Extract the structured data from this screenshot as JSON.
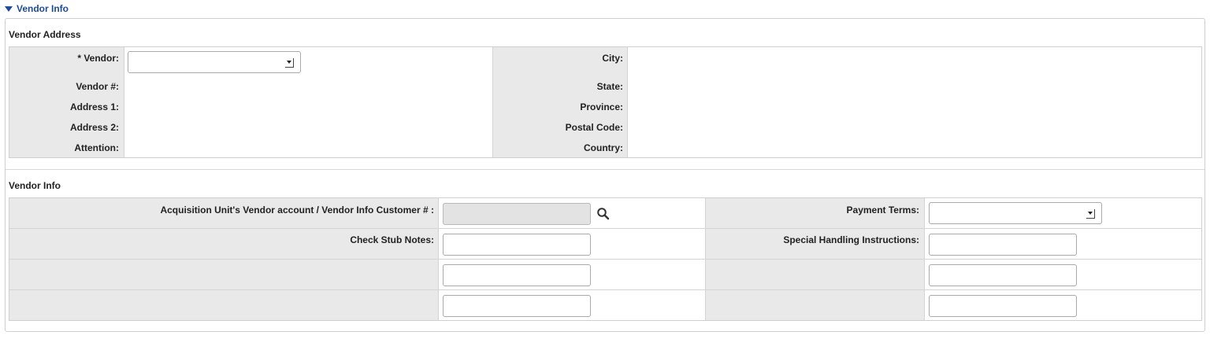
{
  "section": {
    "title": "Vendor Info"
  },
  "address": {
    "title": "Vendor Address",
    "left_labels": [
      "* Vendor:",
      "Vendor #:",
      "Address 1:",
      "Address 2:",
      "Attention:"
    ],
    "right_labels": [
      "City:",
      "State:",
      "Province:",
      "Postal Code:",
      "Country:"
    ],
    "vendor_value": ""
  },
  "vendor_info": {
    "title": "Vendor Info",
    "customer_label": "Acquisition Unit's Vendor account / Vendor Info Customer # :",
    "payment_terms_label": "Payment Terms:",
    "check_stub_label": "Check Stub Notes:",
    "special_handling_label": "Special Handling Instructions:",
    "customer_value": "",
    "payment_terms_value": "",
    "check_stub_values": [
      "",
      "",
      ""
    ],
    "special_handling_values": [
      "",
      "",
      ""
    ]
  },
  "icons": {
    "toggle": "triangle-down-icon",
    "search": "search-icon",
    "dropdown": "dropdown-arrow-icon"
  }
}
